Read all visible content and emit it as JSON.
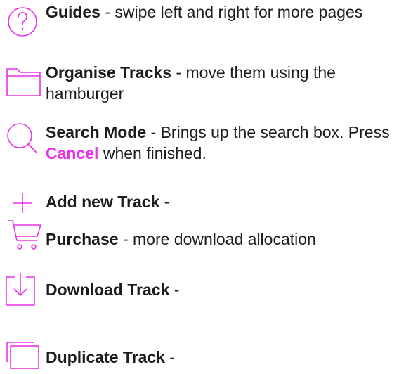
{
  "accent_color": "#e933e8",
  "text_color": "#1c1c1e",
  "items": [
    {
      "icon": "question-mark-circle-icon",
      "title": "Guides",
      "desc": " - swipe left and right for more pages"
    },
    {
      "icon": "folder-icon",
      "title": "Organise Tracks",
      "desc": " - move them using the hamburger"
    },
    {
      "icon": "magnifier-icon",
      "title": "Search Mode",
      "desc": " - Brings up the search box. Press ",
      "highlight": "Cancel",
      "desc_after": " when finished."
    },
    {
      "icon": "plus-icon",
      "title": "Add new Track",
      "desc": " -"
    },
    {
      "icon": "shopping-cart-icon",
      "title": "Purchase",
      "desc": " - more download allocation"
    },
    {
      "icon": "download-tray-icon",
      "title": "Download Track",
      "desc": " -"
    },
    {
      "icon": "duplicate-icon",
      "title": "Duplicate Track",
      "desc": " -"
    }
  ]
}
